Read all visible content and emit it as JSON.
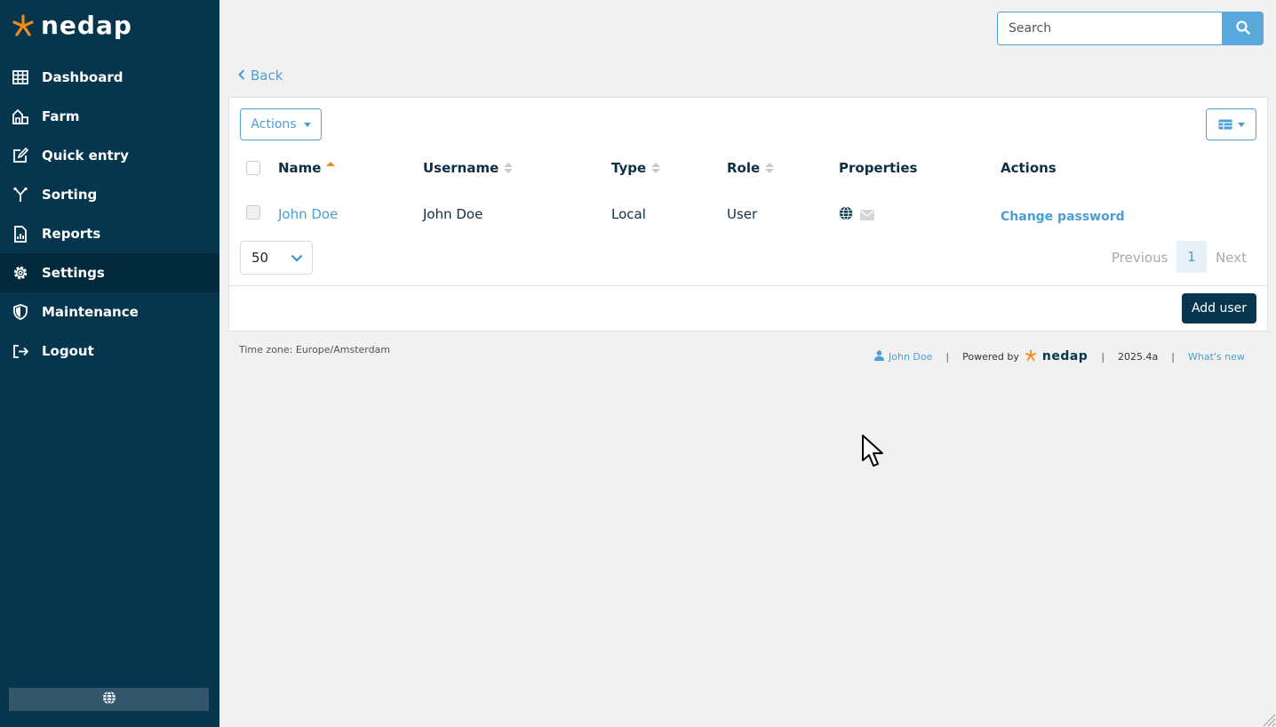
{
  "brand": {
    "name": "nedap",
    "accent": "#f08a1a",
    "sidebar_bg": "#05364d",
    "link_color": "#4a9fd5"
  },
  "sidebar": {
    "items": [
      {
        "label": "Dashboard",
        "icon": "grid-icon"
      },
      {
        "label": "Farm",
        "icon": "farm-icon"
      },
      {
        "label": "Quick entry",
        "icon": "edit-icon"
      },
      {
        "label": "Sorting",
        "icon": "sorting-icon"
      },
      {
        "label": "Reports",
        "icon": "report-icon"
      },
      {
        "label": "Settings",
        "icon": "gear-icon",
        "active": true
      },
      {
        "label": "Maintenance",
        "icon": "shield-icon"
      },
      {
        "label": "Logout",
        "icon": "logout-icon"
      }
    ],
    "language_icon": "globe-icon"
  },
  "search": {
    "placeholder": "Search",
    "value": ""
  },
  "back_label": "Back",
  "toolbar": {
    "actions_label": "Actions",
    "view_icon": "table-view-icon"
  },
  "table": {
    "columns": [
      "Name",
      "Username",
      "Type",
      "Role",
      "Properties",
      "Actions"
    ],
    "sorted_column": "Name",
    "rows": [
      {
        "name": "John Doe",
        "username": "John Doe",
        "type": "Local",
        "role": "User",
        "properties": [
          "globe-icon",
          "envelope-icon"
        ],
        "action": "Change password"
      }
    ]
  },
  "pagination": {
    "page_size": "50",
    "previous": "Previous",
    "current": "1",
    "next": "Next"
  },
  "add_user_label": "Add user",
  "footer": {
    "timezone": "Time zone: Europe/Amsterdam",
    "user": "John Doe",
    "powered_by": "Powered by",
    "brand": "nedap",
    "version": "2025.4a",
    "whats_new": "What's new"
  }
}
